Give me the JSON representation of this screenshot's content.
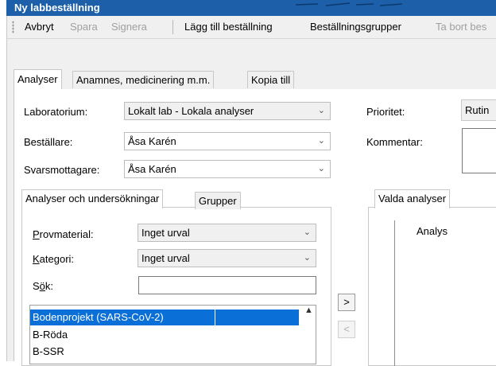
{
  "window": {
    "title": "Ny labbeställning"
  },
  "toolbar": {
    "cancel": "Avbryt",
    "save": "Spara",
    "sign": "Signera",
    "add_order": "Lägg till beställning",
    "order_groups": "Beställningsgrupper",
    "remove_order": "Ta bort bes"
  },
  "tabs": [
    "Analyser",
    "Anamnes, medicinering m.m.",
    "Kopia till"
  ],
  "form": {
    "laboratory_label": "Laboratorium:",
    "laboratory_value": "Lokalt lab - Lokala analyser",
    "orderer_label": "Beställare:",
    "orderer_value": "Åsa Karén",
    "recipient_label": "Svarsmottagare:",
    "recipient_value": "Åsa Karén",
    "priority_label": "Prioritet:",
    "priority_value": "Rutin",
    "comment_label": "Kommentar:"
  },
  "left_panel": {
    "tabs": [
      "Analyser och undersökningar",
      "Grupper"
    ],
    "specimen_label": "Provmaterial:",
    "specimen_value": "Inget urval",
    "category_label": "Kategori:",
    "category_value": "Inget urval",
    "search_label": "Sök:",
    "search_value": "",
    "items": [
      "Bodenprojekt (SARS-CoV-2)",
      "B-Röda",
      "B-SSR"
    ]
  },
  "move_buttons": {
    "add": ">",
    "remove": "<"
  },
  "right_panel": {
    "tab": "Valda analyser",
    "column_header": "Analys"
  }
}
